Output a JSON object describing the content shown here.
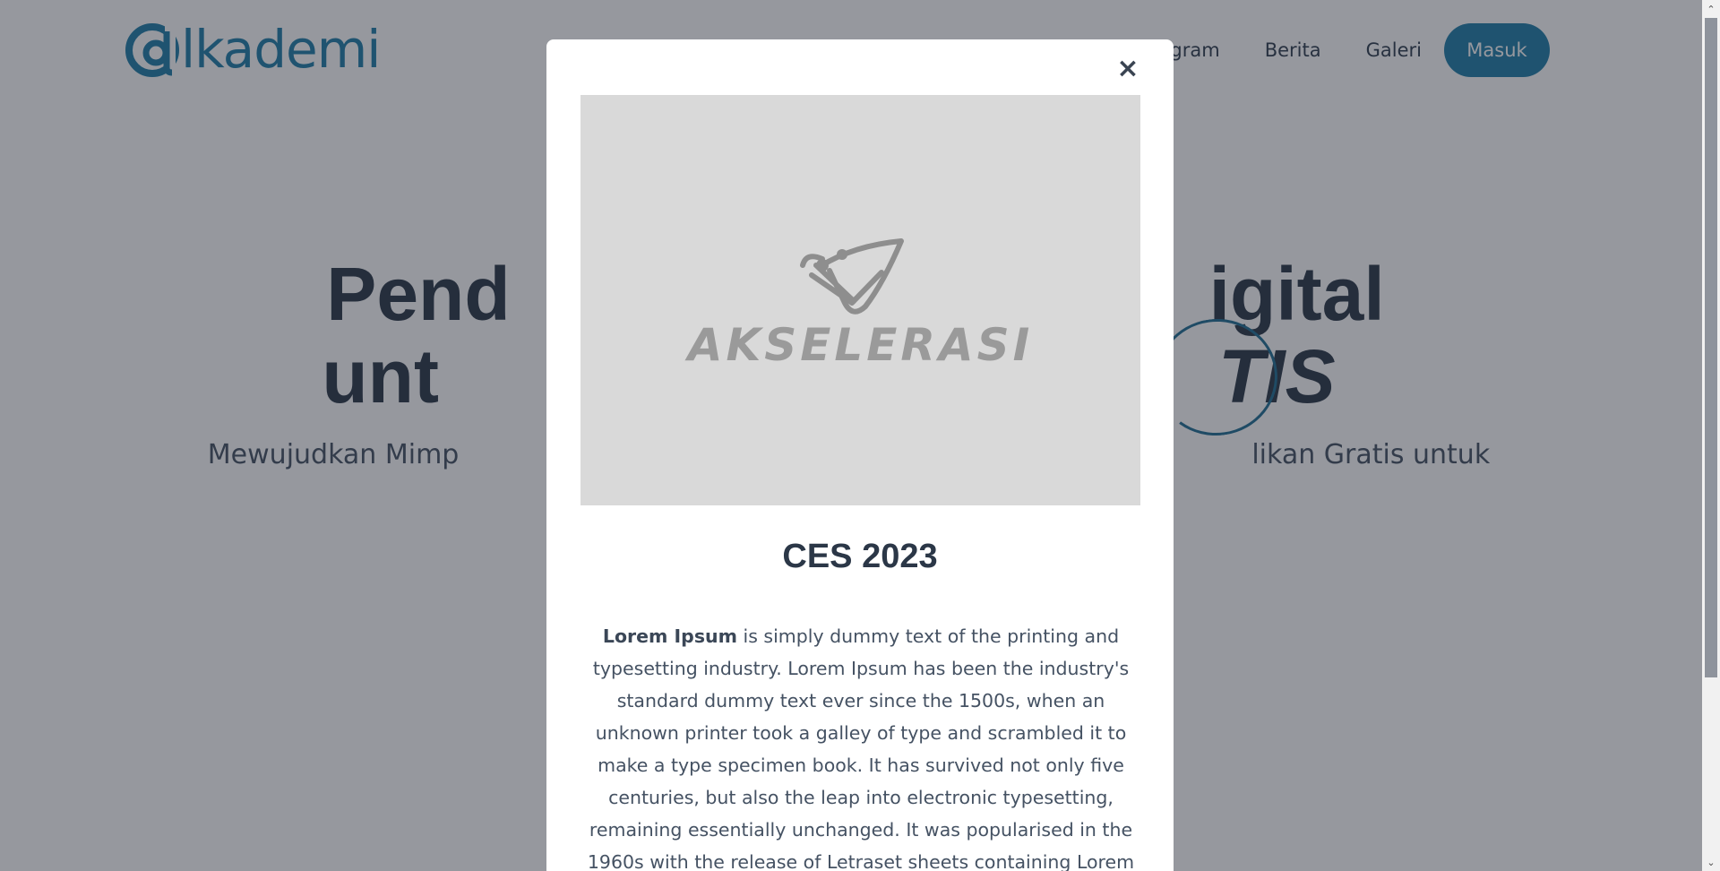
{
  "header": {
    "logo_text": "lkademi",
    "logo_alt": "Alkademi",
    "nav": [
      {
        "label": "ogram"
      },
      {
        "label": "Berita"
      },
      {
        "label": "Galeri"
      }
    ],
    "login_label": "Masuk"
  },
  "hero": {
    "line1_left": "Pend",
    "line1_right": "igital",
    "line2_left": "unt",
    "line2_right": "TIS",
    "subtitle_left": "Mewujudkan Mimp",
    "subtitle_right": "likan Gratis untuk"
  },
  "modal": {
    "close_glyph": "×",
    "image_logo_text": "AKSELERASI",
    "title": "CES 2023",
    "body_bold": "Lorem Ipsum",
    "body_text": " is simply dummy text of the printing and typesetting industry. Lorem Ipsum has been the industry's standard dummy text ever since the 1500s, when an unknown printer took a galley of type and scrambled it to make a type specimen book. It has survived not only five centuries, but also the leap into electronic typesetting, remaining essentially unchanged. It was popularised in the 1960s with the release of Letraset sheets containing Lorem Ipsum passages, and more recently with desktop publishing"
  },
  "scrollbar": {
    "up_glyph": "⌃",
    "down_glyph": "⌄"
  },
  "colors": {
    "brand": "#1f7ea8",
    "heading": "#2b3747",
    "overlay": "rgba(32,36,48,0.47)"
  }
}
